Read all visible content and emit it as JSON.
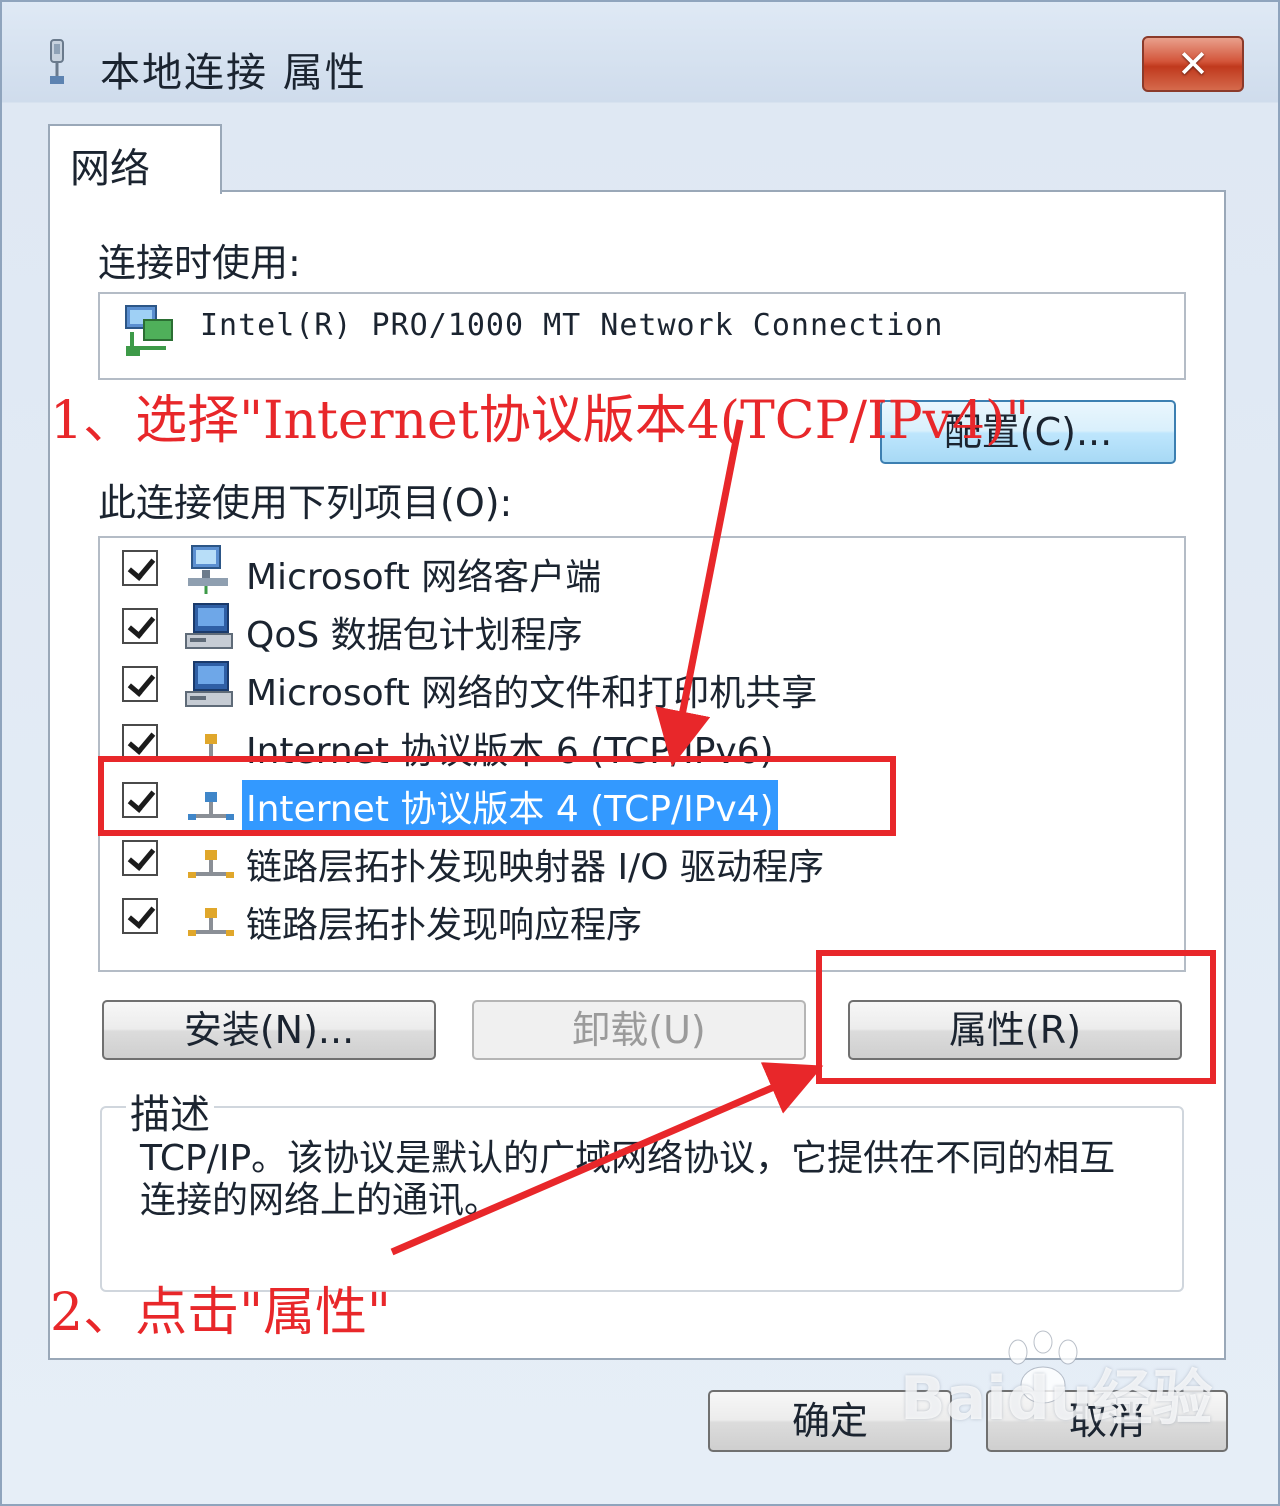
{
  "window": {
    "title": "本地连接 属性",
    "close_label": "✕"
  },
  "tabs": [
    {
      "label": "网络"
    }
  ],
  "connect_using": {
    "label": "连接时使用:",
    "adapter": "Intel(R) PRO/1000 MT Network Connection",
    "configure_button": "配置(C)..."
  },
  "items_section": {
    "label": "此连接使用下列项目(O):",
    "items": [
      {
        "label": "Microsoft 网络客户端",
        "checked": true,
        "icon": "network-client-icon",
        "selected": false
      },
      {
        "label": "QoS 数据包计划程序",
        "checked": true,
        "icon": "computer-service-icon",
        "selected": false
      },
      {
        "label": "Microsoft 网络的文件和打印机共享",
        "checked": true,
        "icon": "computer-service-icon",
        "selected": false
      },
      {
        "label": "Internet 协议版本 6 (TCP/IPv6)",
        "checked": true,
        "icon": "protocol-icon",
        "selected": false
      },
      {
        "label": "Internet 协议版本 4 (TCP/IPv4)",
        "checked": true,
        "icon": "protocol-icon",
        "selected": true
      },
      {
        "label": "链路层拓扑发现映射器 I/O 驱动程序",
        "checked": true,
        "icon": "protocol-icon",
        "selected": false
      },
      {
        "label": "链路层拓扑发现响应程序",
        "checked": true,
        "icon": "protocol-icon",
        "selected": false
      }
    ]
  },
  "buttons": {
    "install": "安装(N)...",
    "uninstall": "卸载(U)",
    "properties": "属性(R)",
    "ok": "确定",
    "cancel": "取消"
  },
  "description": {
    "title": "描述",
    "text": "TCP/IP。该协议是默认的广域网络协议，它提供在不同的相互连接的网络上的通讯。"
  },
  "annotations": {
    "step1": "1、选择\"Internet协议版本4(TCP/IPv4)\"",
    "step2": "2、点击\"属性\"",
    "color": "#e8272a"
  },
  "watermark": "Baidu经验"
}
